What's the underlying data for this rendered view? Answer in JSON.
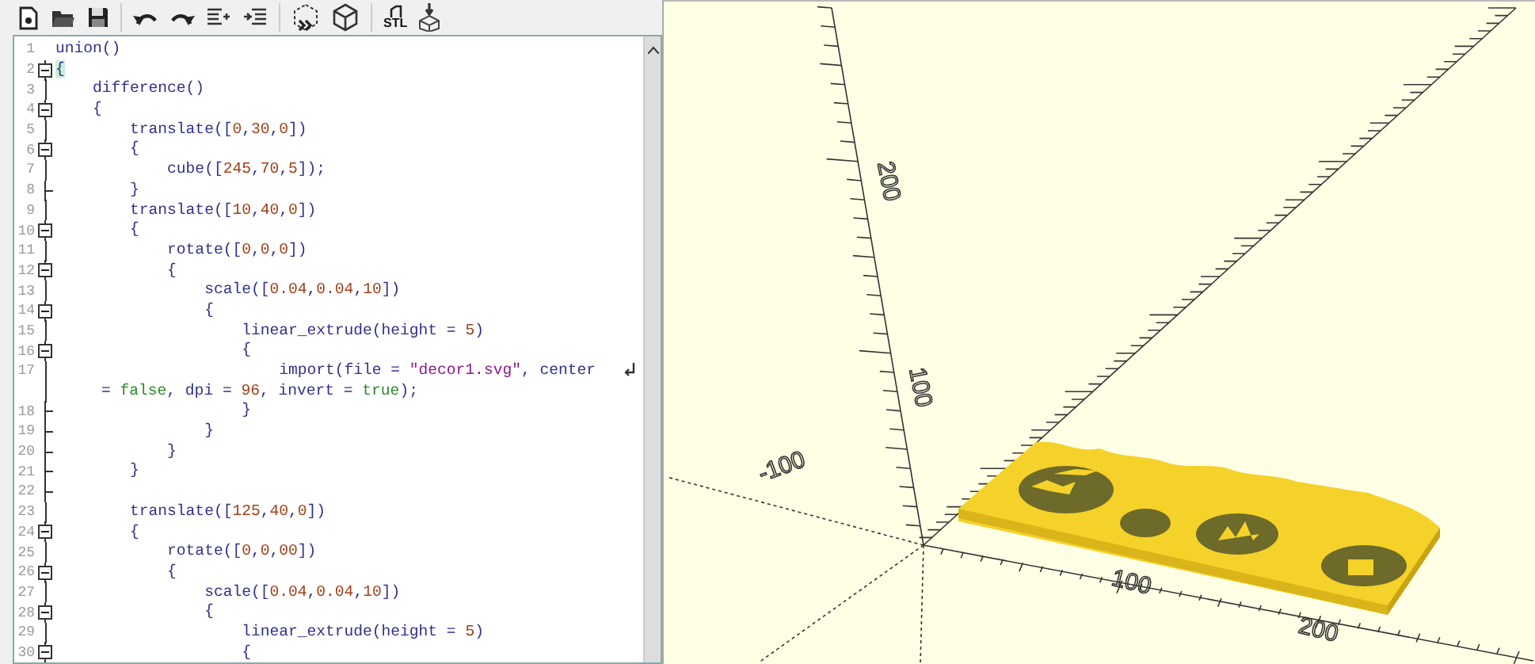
{
  "toolbar": {
    "stl_label": "STL"
  },
  "editor": {
    "lines": [
      {
        "number": "1",
        "kind": "plain",
        "segments": [
          {
            "kind": "code",
            "text": "union()"
          }
        ]
      },
      {
        "number": "2",
        "kind": "fold-start",
        "segments": [
          {
            "kind": "brace-match",
            "text": "{"
          }
        ]
      },
      {
        "number": "3",
        "kind": "fold-body",
        "segments": [
          {
            "kind": "code",
            "text": "    difference()"
          }
        ]
      },
      {
        "number": "4",
        "kind": "fold-start",
        "segments": [
          {
            "kind": "code",
            "text": "    {"
          }
        ]
      },
      {
        "number": "5",
        "kind": "fold-body",
        "segments": [
          {
            "kind": "code",
            "text": "        translate(["
          },
          {
            "kind": "number",
            "text": "0"
          },
          {
            "kind": "code",
            "text": ","
          },
          {
            "kind": "number",
            "text": "30"
          },
          {
            "kind": "code",
            "text": ","
          },
          {
            "kind": "number",
            "text": "0"
          },
          {
            "kind": "code",
            "text": "])"
          }
        ]
      },
      {
        "number": "6",
        "kind": "fold-start",
        "segments": [
          {
            "kind": "code",
            "text": "        {"
          }
        ]
      },
      {
        "number": "7",
        "kind": "fold-body",
        "segments": [
          {
            "kind": "code",
            "text": "            cube(["
          },
          {
            "kind": "number",
            "text": "245"
          },
          {
            "kind": "code",
            "text": ","
          },
          {
            "kind": "number",
            "text": "70"
          },
          {
            "kind": "code",
            "text": ","
          },
          {
            "kind": "number",
            "text": "5"
          },
          {
            "kind": "code",
            "text": "]);"
          }
        ]
      },
      {
        "number": "8",
        "kind": "fold-end",
        "segments": [
          {
            "kind": "code",
            "text": "        }"
          }
        ]
      },
      {
        "number": "9",
        "kind": "fold-body",
        "segments": [
          {
            "kind": "code",
            "text": "        translate(["
          },
          {
            "kind": "number",
            "text": "10"
          },
          {
            "kind": "code",
            "text": ","
          },
          {
            "kind": "number",
            "text": "40"
          },
          {
            "kind": "code",
            "text": ","
          },
          {
            "kind": "number",
            "text": "0"
          },
          {
            "kind": "code",
            "text": "])"
          }
        ]
      },
      {
        "number": "10",
        "kind": "fold-start",
        "segments": [
          {
            "kind": "code",
            "text": "        {"
          }
        ]
      },
      {
        "number": "11",
        "kind": "fold-body",
        "segments": [
          {
            "kind": "code",
            "text": "            rotate(["
          },
          {
            "kind": "number",
            "text": "0"
          },
          {
            "kind": "code",
            "text": ","
          },
          {
            "kind": "number",
            "text": "0"
          },
          {
            "kind": "code",
            "text": ","
          },
          {
            "kind": "number",
            "text": "0"
          },
          {
            "kind": "code",
            "text": "])"
          }
        ]
      },
      {
        "number": "12",
        "kind": "fold-start",
        "segments": [
          {
            "kind": "code",
            "text": "            {"
          }
        ]
      },
      {
        "number": "13",
        "kind": "fold-body",
        "segments": [
          {
            "kind": "code",
            "text": "                scale(["
          },
          {
            "kind": "number",
            "text": "0.04"
          },
          {
            "kind": "code",
            "text": ","
          },
          {
            "kind": "number",
            "text": "0.04"
          },
          {
            "kind": "code",
            "text": ","
          },
          {
            "kind": "number",
            "text": "10"
          },
          {
            "kind": "code",
            "text": "])"
          }
        ]
      },
      {
        "number": "14",
        "kind": "fold-start",
        "segments": [
          {
            "kind": "code",
            "text": "                {"
          }
        ]
      },
      {
        "number": "15",
        "kind": "fold-body",
        "segments": [
          {
            "kind": "code",
            "text": "                    linear_extrude(height = "
          },
          {
            "kind": "number",
            "text": "5"
          },
          {
            "kind": "code",
            "text": ")"
          }
        ]
      },
      {
        "number": "16",
        "kind": "fold-start",
        "segments": [
          {
            "kind": "code",
            "text": "                    {"
          }
        ]
      },
      {
        "number": "17",
        "kind": "fold-body",
        "segments": [
          {
            "kind": "code",
            "text": "                        import(file = "
          },
          {
            "kind": "string",
            "text": "\"decor1.svg\""
          },
          {
            "kind": "code",
            "text": ", center"
          }
        ],
        "wrap_segments": [
          {
            "kind": "code",
            "text": "= "
          },
          {
            "kind": "literal",
            "text": "false"
          },
          {
            "kind": "code",
            "text": ", dpi = "
          },
          {
            "kind": "number",
            "text": "96"
          },
          {
            "kind": "code",
            "text": ", invert = "
          },
          {
            "kind": "literal",
            "text": "true"
          },
          {
            "kind": "code",
            "text": ");"
          }
        ]
      },
      {
        "number": "18",
        "kind": "fold-end",
        "segments": [
          {
            "kind": "code",
            "text": "                    }"
          }
        ]
      },
      {
        "number": "19",
        "kind": "fold-end",
        "segments": [
          {
            "kind": "code",
            "text": "                }"
          }
        ]
      },
      {
        "number": "20",
        "kind": "fold-end",
        "segments": [
          {
            "kind": "code",
            "text": "            }"
          }
        ]
      },
      {
        "number": "21",
        "kind": "fold-end",
        "segments": [
          {
            "kind": "code",
            "text": "        }"
          }
        ]
      },
      {
        "number": "22",
        "kind": "fold-end"
      },
      {
        "number": "23",
        "kind": "fold-body",
        "segments": [
          {
            "kind": "code",
            "text": "        translate(["
          },
          {
            "kind": "number",
            "text": "125"
          },
          {
            "kind": "code",
            "text": ","
          },
          {
            "kind": "number",
            "text": "40"
          },
          {
            "kind": "code",
            "text": ","
          },
          {
            "kind": "number",
            "text": "0"
          },
          {
            "kind": "code",
            "text": "])"
          }
        ]
      },
      {
        "number": "24",
        "kind": "fold-start",
        "segments": [
          {
            "kind": "code",
            "text": "        {"
          }
        ]
      },
      {
        "number": "25",
        "kind": "fold-body",
        "segments": [
          {
            "kind": "code",
            "text": "            rotate(["
          },
          {
            "kind": "number",
            "text": "0"
          },
          {
            "kind": "code",
            "text": ","
          },
          {
            "kind": "number",
            "text": "0"
          },
          {
            "kind": "code",
            "text": ","
          },
          {
            "kind": "number",
            "text": "00"
          },
          {
            "kind": "code",
            "text": "])"
          }
        ]
      },
      {
        "number": "26",
        "kind": "fold-start",
        "segments": [
          {
            "kind": "code",
            "text": "            {"
          }
        ]
      },
      {
        "number": "27",
        "kind": "fold-body",
        "segments": [
          {
            "kind": "code",
            "text": "                scale(["
          },
          {
            "kind": "number",
            "text": "0.04"
          },
          {
            "kind": "code",
            "text": ","
          },
          {
            "kind": "number",
            "text": "0.04"
          },
          {
            "kind": "code",
            "text": ","
          },
          {
            "kind": "number",
            "text": "10"
          },
          {
            "kind": "code",
            "text": "])"
          }
        ]
      },
      {
        "number": "28",
        "kind": "fold-start",
        "segments": [
          {
            "kind": "code",
            "text": "                {"
          }
        ]
      },
      {
        "number": "29",
        "kind": "fold-body",
        "segments": [
          {
            "kind": "code",
            "text": "                    linear_extrude(height = "
          },
          {
            "kind": "number",
            "text": "5"
          },
          {
            "kind": "code",
            "text": ")"
          }
        ]
      },
      {
        "number": "30",
        "kind": "fold-start",
        "segments": [
          {
            "kind": "code",
            "text": "                    {"
          }
        ]
      }
    ]
  },
  "viewport": {
    "axis_labels": [
      {
        "kind": "z",
        "text": "200"
      },
      {
        "kind": "z",
        "text": "100"
      },
      {
        "kind": "neg-x",
        "text": "-100"
      },
      {
        "kind": "x",
        "text": "100"
      },
      {
        "kind": "x",
        "text": "200"
      }
    ]
  }
}
